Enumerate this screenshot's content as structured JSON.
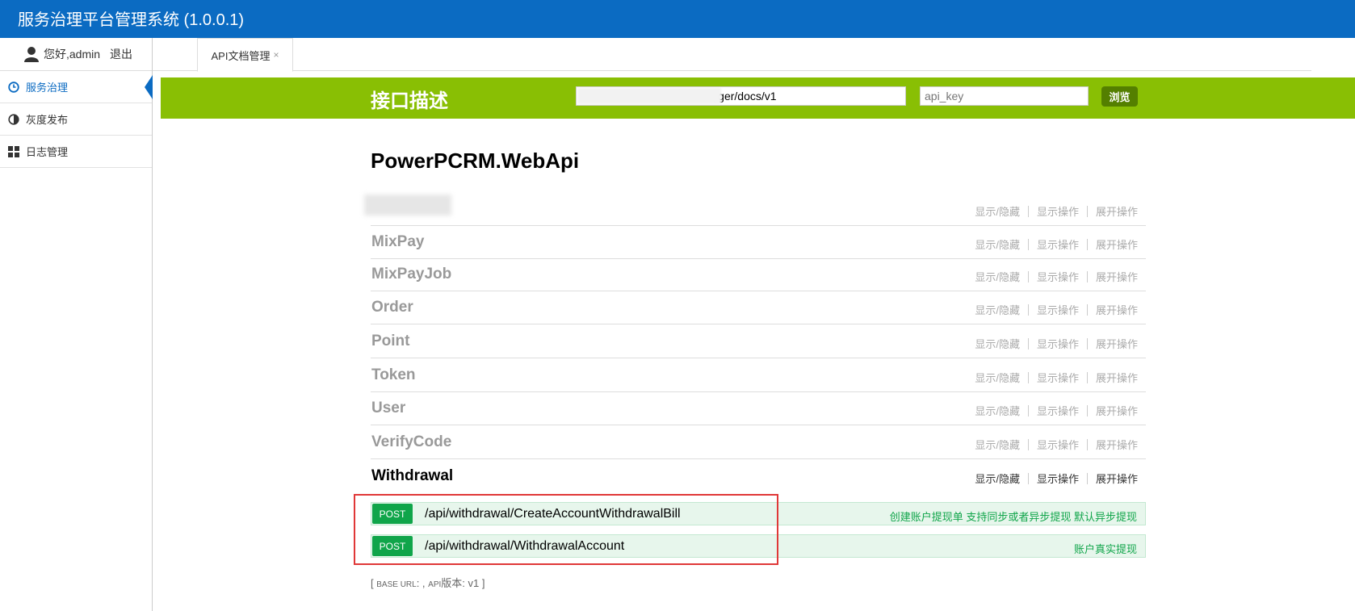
{
  "app": {
    "title": "服务治理平台管理系统 (1.0.0.1)"
  },
  "user": {
    "greeting": "您好,admin",
    "logout": "退出"
  },
  "sidebar": {
    "items": [
      {
        "label": "服务治理",
        "icon": "clock-icon",
        "active": true
      },
      {
        "label": "灰度发布",
        "icon": "half-circle-icon",
        "active": false
      },
      {
        "label": "日志管理",
        "icon": "grid-icon",
        "active": false
      }
    ]
  },
  "tabs": [
    {
      "label": "API文档管理",
      "close": "×"
    }
  ],
  "swagger": {
    "logo": "接口描述",
    "url_value": "h                                        gger/docs/v1",
    "api_key_placeholder": "api_key",
    "explore_label": "浏览"
  },
  "api": {
    "title": "PowerPCRM.WebApi"
  },
  "resource_ops": {
    "toggle": "显示/隐藏",
    "list": "显示操作",
    "expand": "展开操作"
  },
  "resources": [
    {
      "name": "",
      "blurred": true
    },
    {
      "name": "MixPay"
    },
    {
      "name": "MixPayJob"
    },
    {
      "name": "Order"
    },
    {
      "name": "Point"
    },
    {
      "name": "Token"
    },
    {
      "name": "User"
    },
    {
      "name": "VerifyCode"
    },
    {
      "name": "Withdrawal",
      "expanded": true
    }
  ],
  "endpoints": [
    {
      "method": "POST",
      "path": "/api/withdrawal/CreateAccountWithdrawalBill",
      "summary": "创建账户提现单 支持同步或者异步提现 默认异步提现"
    },
    {
      "method": "POST",
      "path": "/api/withdrawal/WithdrawalAccount",
      "summary": "账户真实提现"
    }
  ],
  "footer": {
    "open": "[ ",
    "base_url_label": "BASE URL",
    "after_base": ": , ",
    "api_label": "API",
    "version_text": "版本: v1",
    "close": " ]"
  },
  "colors": {
    "topbar": "#0b6bc2",
    "swagger_green": "#89bf04",
    "post_green": "#10a54a",
    "highlight_red": "#e03838"
  }
}
